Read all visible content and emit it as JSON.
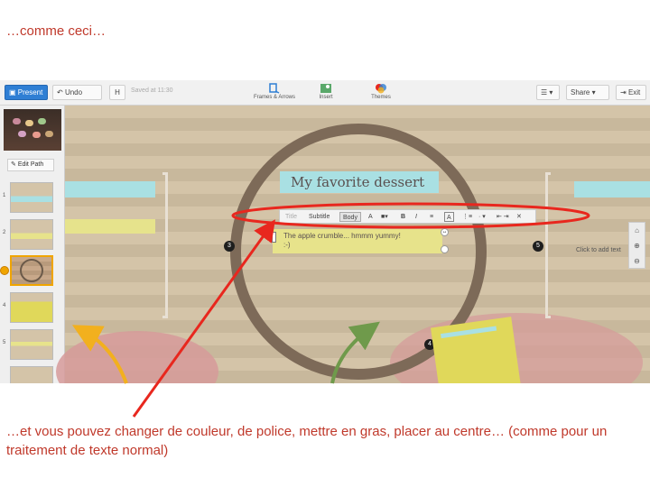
{
  "captions": {
    "top": "…comme ceci…",
    "bottom": "…et vous pouvez changer de couleur, de police, mettre en gras, placer au centre… (comme pour un traitement de texte normal)"
  },
  "toolbar": {
    "present_label": "Present",
    "undo_label": "Undo",
    "h_label": "H",
    "saved_text": "Saved at 11:30",
    "frames_label": "Frames & Arrows",
    "insert_label": "Insert",
    "themes_label": "Themes",
    "share_label": "Share",
    "exit_label": "Exit"
  },
  "sidebar": {
    "edit_path_label": "Edit Path",
    "slide_numbers": [
      "1",
      "2",
      "3",
      "4",
      "5"
    ]
  },
  "canvas": {
    "title_text": "My favorite dessert",
    "body_line1": "The apple crumble... hmmm yummy!",
    "body_line2": ":-)",
    "click_to_add": "Click to add text",
    "badges": [
      "3",
      "5",
      "4"
    ]
  },
  "format_bar": {
    "style_title": "Title",
    "style_subtitle": "Subtitle",
    "style_body": "Body",
    "font_label": "A",
    "bold": "B",
    "italic": "I"
  },
  "colors": {
    "caption": "#c0392b",
    "annotation_red": "#e8271e",
    "annotation_yellow": "#f2b01e",
    "annotation_green": "#6f9a4b",
    "title_box": "#a9e0e3",
    "body_box": "#e7e38b",
    "circle": "#7d6a58"
  }
}
